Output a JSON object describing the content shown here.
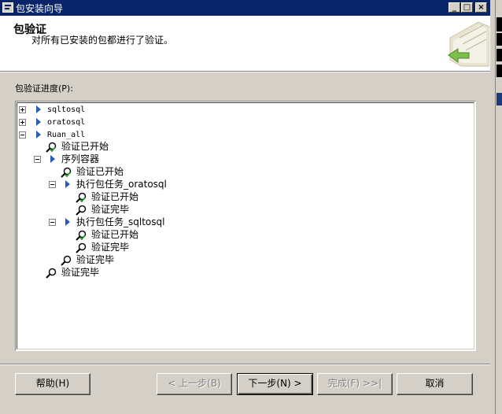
{
  "window": {
    "title": "包安装向导"
  },
  "header": {
    "title": "包验证",
    "subtitle": "对所有已安装的包都进行了验证。"
  },
  "progress_label": "包验证进度(P):",
  "tree": [
    {
      "text": "sqltosql",
      "kind": "package",
      "expander": "plus"
    },
    {
      "text": "oratosql",
      "kind": "package",
      "expander": "plus"
    },
    {
      "text": "Ruan_all",
      "kind": "package",
      "expander": "minus"
    },
    {
      "text": "验证已开始",
      "kind": "started"
    },
    {
      "text": "序列容器",
      "kind": "container",
      "expander": "minus"
    },
    {
      "text": "验证已开始",
      "kind": "started"
    },
    {
      "text": "执行包任务_oratosql",
      "kind": "task",
      "expander": "minus"
    },
    {
      "text": "验证已开始",
      "kind": "started"
    },
    {
      "text": "验证完毕",
      "kind": "done"
    },
    {
      "text": "执行包任务_sqltosql",
      "kind": "task",
      "expander": "minus"
    },
    {
      "text": "验证已开始",
      "kind": "started"
    },
    {
      "text": "验证完毕",
      "kind": "done"
    },
    {
      "text": "验证完毕",
      "kind": "done"
    },
    {
      "text": "验证完毕",
      "kind": "done"
    }
  ],
  "buttons": {
    "help": "帮助(H)",
    "back": "< 上一步(B)",
    "next": "下一步(N) >",
    "finish": "完成(F) >>|",
    "cancel": "取消"
  },
  "colors": {
    "titlebar": "#0a246a",
    "face": "#d4d0c8",
    "tree_arrow": "#2a5bb8"
  }
}
